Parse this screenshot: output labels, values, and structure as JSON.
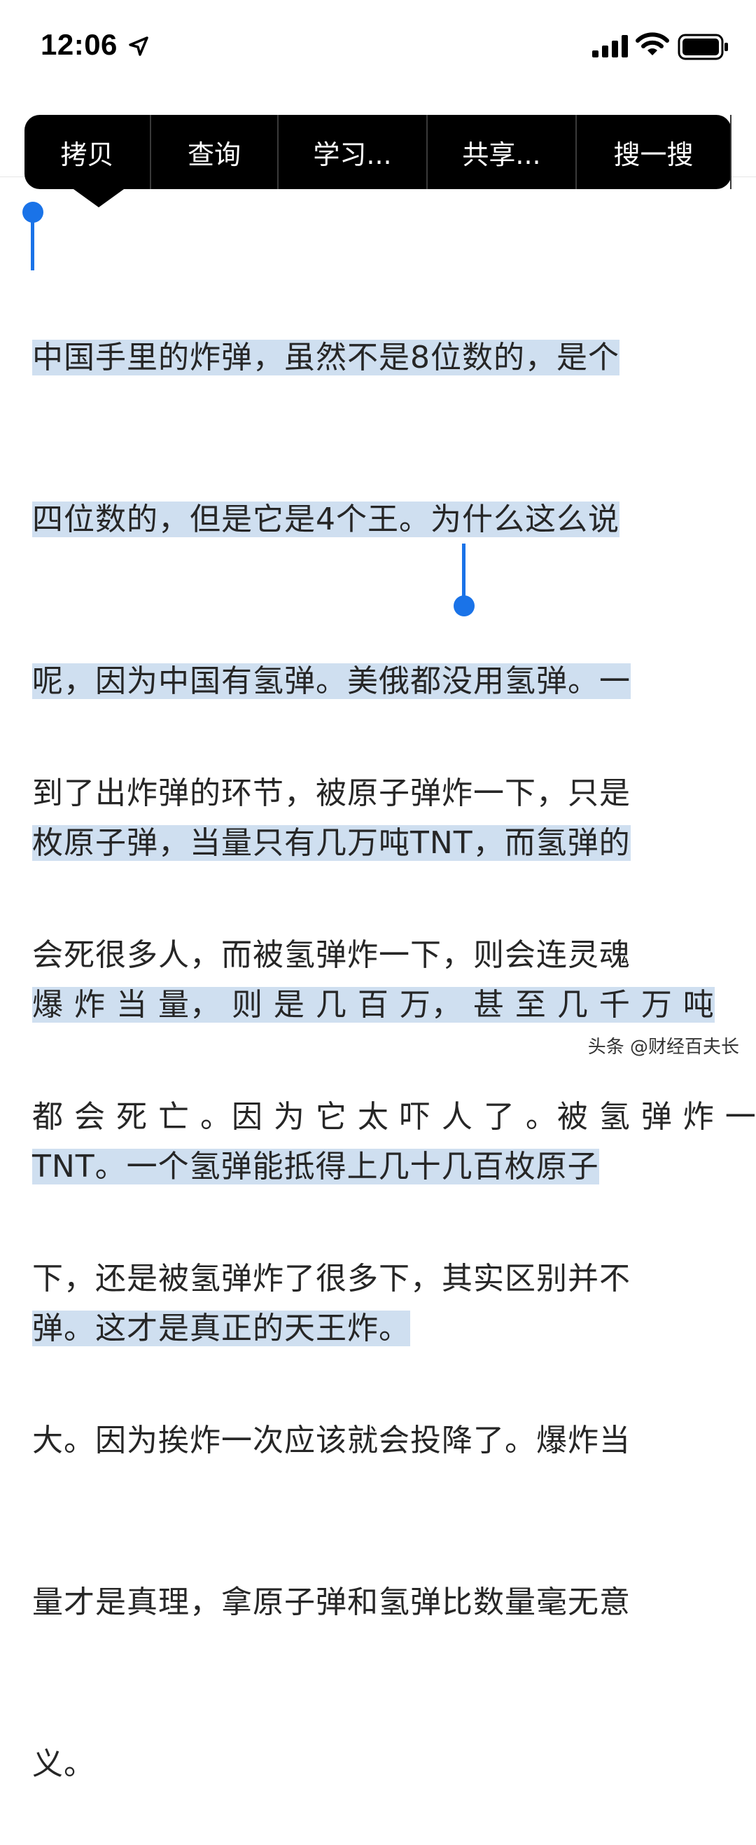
{
  "status_bar": {
    "time": "12:06",
    "icons": [
      "location-arrow-icon",
      "cellular-signal-icon",
      "wifi-icon",
      "battery-icon"
    ]
  },
  "context_menu": {
    "items": [
      {
        "label": "拷贝"
      },
      {
        "label": "查询"
      },
      {
        "label": "学习..."
      },
      {
        "label": "共享..."
      },
      {
        "label": "搜一搜"
      }
    ]
  },
  "paragraph_1": {
    "selected": true,
    "lines": [
      "中国手里的炸弹，虽然不是8位数的，是个",
      "四位数的，但是它是4个王。为什么这么说",
      "呢，因为中国有氢弹。美俄都没用氢弹。一",
      "枚原子弹，当量只有几万吨TNT，而氢弹的",
      "爆 炸 当 量， 则 是 几 百 万， 甚 至 几 千 万 吨",
      "TNT。一个氢弹能抵得上几十几百枚原子",
      "弹。这才是真正的天王炸。"
    ]
  },
  "paragraph_2": {
    "lines": [
      "到了出炸弹的环节，被原子弹炸一下，只是",
      "会死很多人，而被氢弹炸一下，则会连灵魂",
      "都 会 死 亡 。因 为 它 太 吓 人 了 。被 氢 弹 炸 一",
      "下，还是被氢弹炸了很多下，其实区别并不",
      "大。因为挨炸一次应该就会投降了。爆炸当",
      "量才是真理，拿原子弹和氢弹比数量毫无意",
      "义。"
    ]
  },
  "watermark": "头条 @财经百夫长",
  "colors": {
    "selection": "#cfdff0",
    "handle": "#1a73e8",
    "menu_bg": "#000000"
  }
}
